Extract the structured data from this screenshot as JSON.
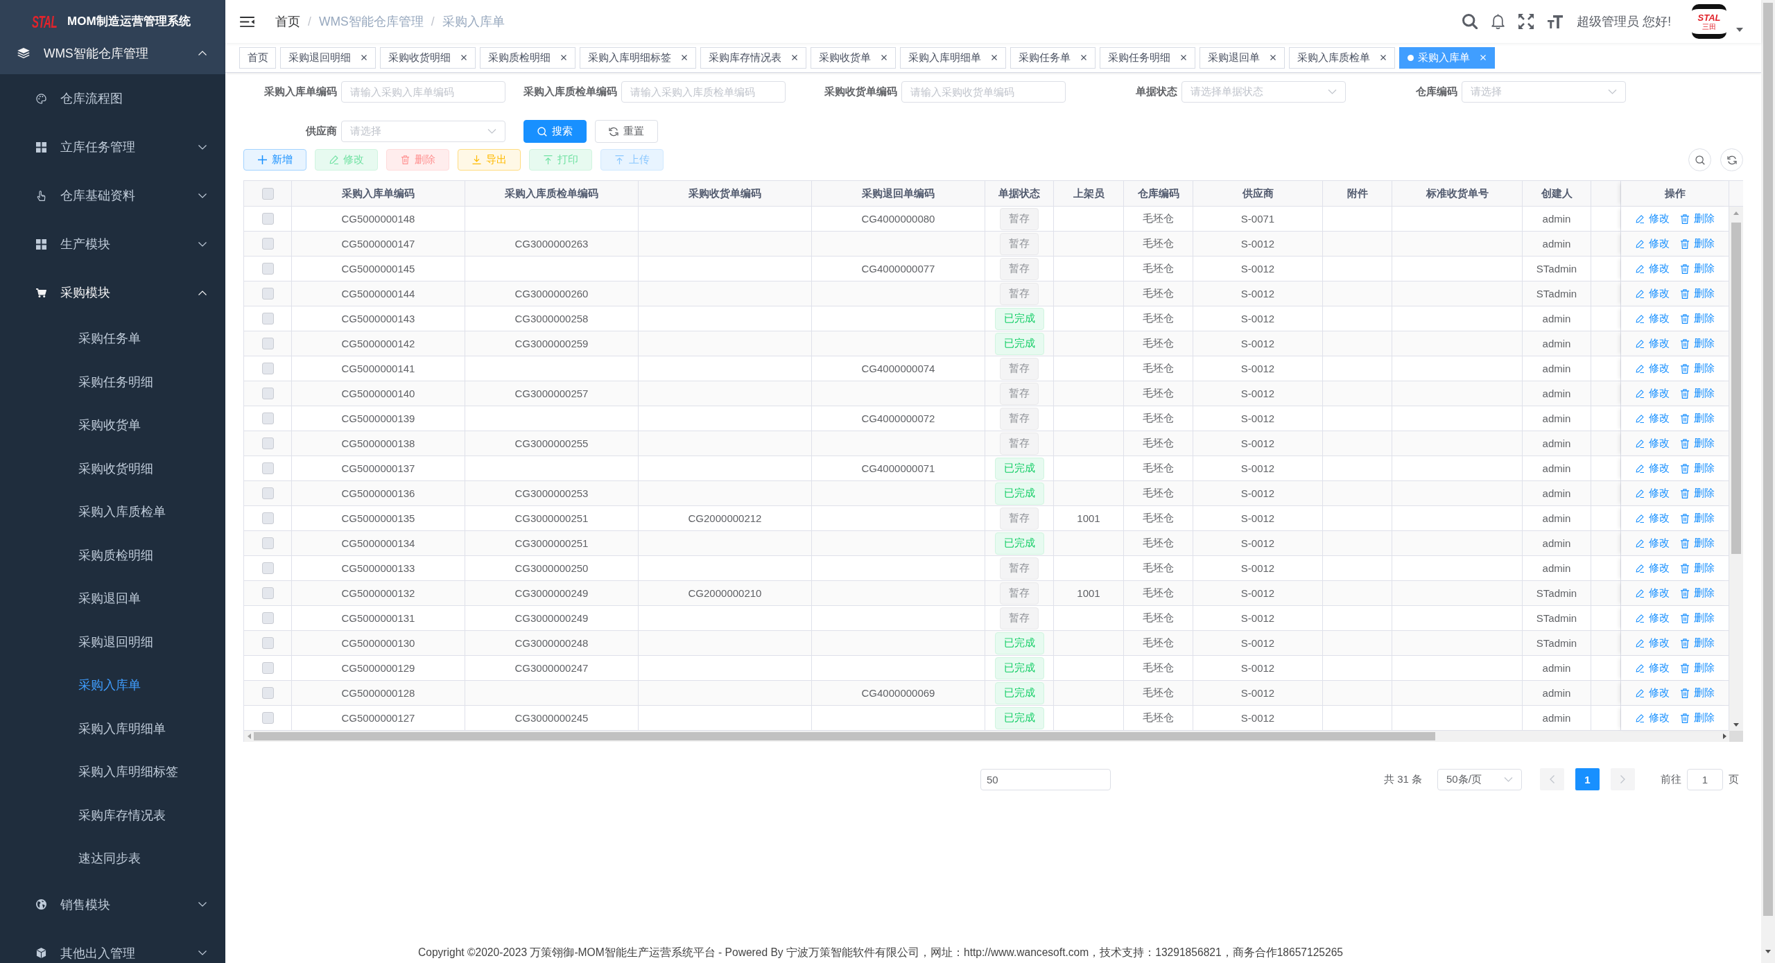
{
  "sidebar": {
    "logo": "STAL",
    "title": "MOM制造运营管理系统",
    "menu": [
      {
        "label": "WMS智能仓库管理",
        "expanded": true,
        "children": [
          {
            "kind": "item",
            "label": "仓库流程图",
            "selected": false
          },
          {
            "kind": "group",
            "label": "立库任务管理",
            "expanded": false
          },
          {
            "kind": "group",
            "label": "仓库基础资料",
            "expanded": false
          },
          {
            "kind": "group",
            "label": "生产模块",
            "expanded": false
          },
          {
            "kind": "group",
            "label": "采购模块",
            "expanded": true,
            "children": [
              {
                "label": "采购任务单",
                "selected": false
              },
              {
                "label": "采购任务明细",
                "selected": false
              },
              {
                "label": "采购收货单",
                "selected": false
              },
              {
                "label": "采购收货明细",
                "selected": false
              },
              {
                "label": "采购入库质检单",
                "selected": false
              },
              {
                "label": "采购质检明细",
                "selected": false
              },
              {
                "label": "采购退回单",
                "selected": false
              },
              {
                "label": "采购退回明细",
                "selected": false
              },
              {
                "label": "采购入库单",
                "selected": true
              },
              {
                "label": "采购入库明细单",
                "selected": false
              },
              {
                "label": "采购入库明细标签",
                "selected": false
              },
              {
                "label": "采购库存情况表",
                "selected": false
              },
              {
                "label": "速达同步表",
                "selected": false
              }
            ]
          },
          {
            "kind": "group",
            "label": "销售模块",
            "expanded": false
          },
          {
            "kind": "group",
            "label": "其他出入管理",
            "expanded": false
          }
        ]
      }
    ]
  },
  "navbar": {
    "breadcrumb": [
      {
        "label": "首页",
        "link": true
      },
      {
        "label": "WMS智能仓库管理",
        "link": false
      },
      {
        "label": "采购入库单",
        "link": false
      }
    ],
    "separator": "/",
    "greeting": "超级管理员 您好!",
    "avatar": {
      "mark": "STAL",
      "sub": "三田"
    }
  },
  "tabs": [
    {
      "label": "首页",
      "selected": false,
      "closable": false
    },
    {
      "label": "采购退回明细",
      "selected": false,
      "closable": true
    },
    {
      "label": "采购收货明细",
      "selected": false,
      "closable": true
    },
    {
      "label": "采购质检明细",
      "selected": false,
      "closable": true
    },
    {
      "label": "采购入库明细标签",
      "selected": false,
      "closable": true
    },
    {
      "label": "采购库存情况表",
      "selected": false,
      "closable": true
    },
    {
      "label": "采购收货单",
      "selected": false,
      "closable": true
    },
    {
      "label": "采购入库明细单",
      "selected": false,
      "closable": true
    },
    {
      "label": "采购任务单",
      "selected": false,
      "closable": true
    },
    {
      "label": "采购任务明细",
      "selected": false,
      "closable": true
    },
    {
      "label": "采购退回单",
      "selected": false,
      "closable": true
    },
    {
      "label": "采购入库质检单",
      "selected": false,
      "closable": true
    },
    {
      "label": "采购入库单",
      "selected": true,
      "closable": true
    }
  ],
  "search_form": {
    "fields": [
      {
        "kind": "input",
        "label": "采购入库单编码",
        "placeholder": "请输入采购入库单编码"
      },
      {
        "kind": "input",
        "label": "采购入库质检单编码",
        "placeholder": "请输入采购入库质检单编码"
      },
      {
        "kind": "input",
        "label": "采购收货单编码",
        "placeholder": "请输入采购收货单编码"
      },
      {
        "kind": "select",
        "label": "单据状态",
        "placeholder": "请选择单据状态"
      },
      {
        "kind": "select",
        "label": "仓库编码",
        "placeholder": "请选择"
      },
      {
        "kind": "select",
        "label": "供应商",
        "placeholder": "请选择"
      }
    ],
    "buttons": [
      {
        "kind": "primary",
        "label": "搜索"
      },
      {
        "kind": "default",
        "label": "重置"
      }
    ]
  },
  "toolbar": {
    "buttons": [
      {
        "kind": "primary",
        "label": "新增",
        "disabled": false
      },
      {
        "kind": "success",
        "label": "修改",
        "disabled": true
      },
      {
        "kind": "danger",
        "label": "删除",
        "disabled": true
      },
      {
        "kind": "warning",
        "label": "导出",
        "disabled": false
      },
      {
        "kind": "success",
        "label": "打印",
        "disabled": true
      },
      {
        "kind": "primary",
        "label": "上传",
        "disabled": true
      }
    ]
  },
  "table": {
    "all_checked": false,
    "columns": [
      "采购入库单编码",
      "采购入库质检单编码",
      "采购收货单编码",
      "采购退回单编码",
      "单据状态",
      "上架员",
      "仓库编码",
      "供应商",
      "附件",
      "标准收货单号",
      "创建人"
    ],
    "action_column": "操作",
    "rows": [
      {
        "checked": false,
        "inbound_no": "CG5000000148",
        "return_no": "CG4000000080",
        "status": {
          "kind": "info",
          "text": "暂存"
        },
        "warehouse": "毛坯仓",
        "supplier": "S-0071",
        "creator": "admin",
        "actions": [
          "修改",
          "删除"
        ]
      },
      {
        "checked": false,
        "inbound_no": "CG5000000147",
        "qc_no": "CG3000000263",
        "status": {
          "kind": "info",
          "text": "暂存"
        },
        "warehouse": "毛坯仓",
        "supplier": "S-0012",
        "creator": "admin",
        "actions": [
          "修改",
          "删除"
        ]
      },
      {
        "checked": false,
        "inbound_no": "CG5000000145",
        "return_no": "CG4000000077",
        "status": {
          "kind": "info",
          "text": "暂存"
        },
        "warehouse": "毛坯仓",
        "supplier": "S-0012",
        "creator": "STadmin",
        "actions": [
          "修改",
          "删除"
        ]
      },
      {
        "checked": false,
        "inbound_no": "CG5000000144",
        "qc_no": "CG3000000260",
        "status": {
          "kind": "info",
          "text": "暂存"
        },
        "warehouse": "毛坯仓",
        "supplier": "S-0012",
        "creator": "STadmin",
        "actions": [
          "修改",
          "删除"
        ]
      },
      {
        "checked": false,
        "inbound_no": "CG5000000143",
        "qc_no": "CG3000000258",
        "status": {
          "kind": "success",
          "text": "已完成"
        },
        "warehouse": "毛坯仓",
        "supplier": "S-0012",
        "creator": "admin",
        "actions": [
          "修改",
          "删除"
        ]
      },
      {
        "checked": false,
        "inbound_no": "CG5000000142",
        "qc_no": "CG3000000259",
        "status": {
          "kind": "success",
          "text": "已完成"
        },
        "warehouse": "毛坯仓",
        "supplier": "S-0012",
        "creator": "admin",
        "actions": [
          "修改",
          "删除"
        ]
      },
      {
        "checked": false,
        "inbound_no": "CG5000000141",
        "return_no": "CG4000000074",
        "status": {
          "kind": "info",
          "text": "暂存"
        },
        "warehouse": "毛坯仓",
        "supplier": "S-0012",
        "creator": "admin",
        "actions": [
          "修改",
          "删除"
        ]
      },
      {
        "checked": false,
        "inbound_no": "CG5000000140",
        "qc_no": "CG3000000257",
        "status": {
          "kind": "info",
          "text": "暂存"
        },
        "warehouse": "毛坯仓",
        "supplier": "S-0012",
        "creator": "admin",
        "actions": [
          "修改",
          "删除"
        ]
      },
      {
        "checked": false,
        "inbound_no": "CG5000000139",
        "return_no": "CG4000000072",
        "status": {
          "kind": "info",
          "text": "暂存"
        },
        "warehouse": "毛坯仓",
        "supplier": "S-0012",
        "creator": "admin",
        "actions": [
          "修改",
          "删除"
        ]
      },
      {
        "checked": false,
        "inbound_no": "CG5000000138",
        "qc_no": "CG3000000255",
        "status": {
          "kind": "info",
          "text": "暂存"
        },
        "warehouse": "毛坯仓",
        "supplier": "S-0012",
        "creator": "admin",
        "actions": [
          "修改",
          "删除"
        ]
      },
      {
        "checked": false,
        "inbound_no": "CG5000000137",
        "return_no": "CG4000000071",
        "status": {
          "kind": "success",
          "text": "已完成"
        },
        "warehouse": "毛坯仓",
        "supplier": "S-0012",
        "creator": "admin",
        "actions": [
          "修改",
          "删除"
        ]
      },
      {
        "checked": false,
        "inbound_no": "CG5000000136",
        "qc_no": "CG3000000253",
        "status": {
          "kind": "success",
          "text": "已完成"
        },
        "warehouse": "毛坯仓",
        "supplier": "S-0012",
        "creator": "admin",
        "actions": [
          "修改",
          "删除"
        ]
      },
      {
        "checked": false,
        "inbound_no": "CG5000000135",
        "qc_no": "CG3000000251",
        "receipt_no": "CG2000000212",
        "status": {
          "kind": "info",
          "text": "暂存"
        },
        "shelver": "1001",
        "warehouse": "毛坯仓",
        "supplier": "S-0012",
        "creator": "admin",
        "actions": [
          "修改",
          "删除"
        ]
      },
      {
        "checked": false,
        "inbound_no": "CG5000000134",
        "qc_no": "CG3000000251",
        "status": {
          "kind": "success",
          "text": "已完成"
        },
        "warehouse": "毛坯仓",
        "supplier": "S-0012",
        "creator": "admin",
        "actions": [
          "修改",
          "删除"
        ]
      },
      {
        "checked": false,
        "inbound_no": "CG5000000133",
        "qc_no": "CG3000000250",
        "status": {
          "kind": "info",
          "text": "暂存"
        },
        "warehouse": "毛坯仓",
        "supplier": "S-0012",
        "creator": "admin",
        "actions": [
          "修改",
          "删除"
        ]
      },
      {
        "checked": false,
        "inbound_no": "CG5000000132",
        "qc_no": "CG3000000249",
        "receipt_no": "CG2000000210",
        "status": {
          "kind": "info",
          "text": "暂存"
        },
        "shelver": "1001",
        "warehouse": "毛坯仓",
        "supplier": "S-0012",
        "creator": "STadmin",
        "actions": [
          "修改",
          "删除"
        ]
      },
      {
        "checked": false,
        "inbound_no": "CG5000000131",
        "qc_no": "CG3000000249",
        "status": {
          "kind": "info",
          "text": "暂存"
        },
        "warehouse": "毛坯仓",
        "supplier": "S-0012",
        "creator": "STadmin",
        "actions": [
          "修改",
          "删除"
        ]
      },
      {
        "checked": false,
        "inbound_no": "CG5000000130",
        "qc_no": "CG3000000248",
        "status": {
          "kind": "success",
          "text": "已完成"
        },
        "warehouse": "毛坯仓",
        "supplier": "S-0012",
        "creator": "STadmin",
        "actions": [
          "修改",
          "删除"
        ]
      },
      {
        "checked": false,
        "inbound_no": "CG5000000129",
        "qc_no": "CG3000000247",
        "status": {
          "kind": "success",
          "text": "已完成"
        },
        "warehouse": "毛坯仓",
        "supplier": "S-0012",
        "creator": "admin",
        "actions": [
          "修改",
          "删除"
        ]
      },
      {
        "checked": false,
        "inbound_no": "CG5000000128",
        "return_no": "CG4000000069",
        "status": {
          "kind": "success",
          "text": "已完成"
        },
        "warehouse": "毛坯仓",
        "supplier": "S-0012",
        "creator": "admin",
        "actions": [
          "修改",
          "删除"
        ]
      },
      {
        "checked": false,
        "inbound_no": "CG5000000127",
        "qc_no": "CG3000000245",
        "status": {
          "kind": "success",
          "text": "已完成"
        },
        "warehouse": "毛坯仓",
        "supplier": "S-0012",
        "creator": "admin",
        "actions": [
          "修改",
          "删除"
        ]
      }
    ]
  },
  "pagination": {
    "size_input": "50",
    "total": "共 31 条",
    "page_size": "50条/页",
    "prev_disabled": true,
    "pages": [
      {
        "label": "1",
        "selected": true
      }
    ],
    "next_disabled": true,
    "jump_label": "前往",
    "jump_value": "1",
    "jump_suffix": "页"
  },
  "footer": "Copyright ©2020-2023 万策翎御-MOM智能生产运营系统平台 - Powered By 宁波万策智能软件有限公司，网址：http://www.wancesoft.com，技术支持：13291856821，商务合作18657125265"
}
